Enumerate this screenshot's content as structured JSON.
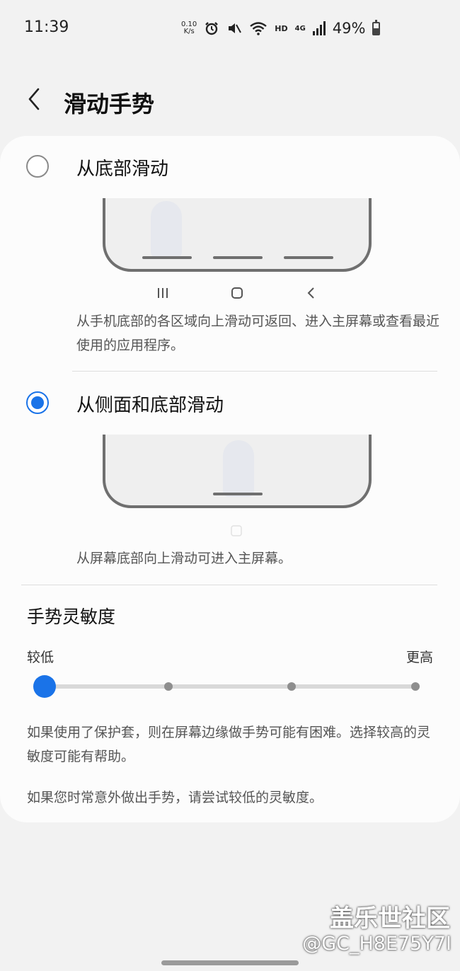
{
  "status_bar": {
    "time": "11:39",
    "net_speed_value": "0.10",
    "net_speed_unit": "K/s",
    "hd": "HD",
    "network": "4G",
    "battery": "49%",
    "battery_level": 0.49
  },
  "header": {
    "title": "滑动手势",
    "back_icon": "chevron-left-icon"
  },
  "options": [
    {
      "label": "从底部滑动",
      "selected": false,
      "description": "从手机底部的各区域向上滑动可返回、进入主屏幕或查看最近使用的应用程序。"
    },
    {
      "label": "从侧面和底部滑动",
      "selected": true,
      "description": "从屏幕底部向上滑动可进入主屏幕。"
    }
  ],
  "nav_icons": [
    "recents-icon",
    "home-icon",
    "back-icon"
  ],
  "sensitivity": {
    "title": "手势灵敏度",
    "low_label": "较低",
    "high_label": "更高",
    "level": 1,
    "levels": 4
  },
  "notes": [
    "如果使用了保护套，则在屏幕边缘做手势可能有困难。选择较高的灵敏度可能有帮助。",
    "如果您时常意外做出手势，请尝试较低的灵敏度。"
  ],
  "watermark": {
    "line1": "盖乐世社区",
    "line2": "@GC_H8E75Y7I"
  },
  "colors": {
    "accent": "#1a73e8",
    "background": "#f2f2f2",
    "card": "#fcfcfc"
  }
}
